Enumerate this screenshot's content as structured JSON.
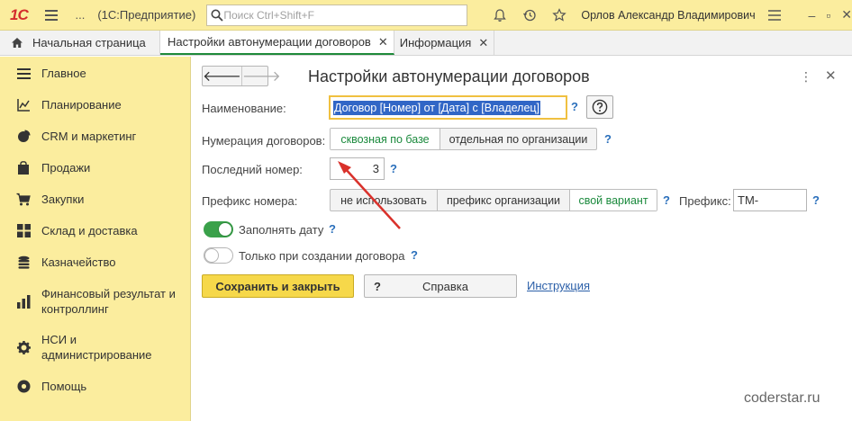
{
  "topbar": {
    "logo_text": "1С",
    "dots": "...",
    "app_title": "(1С:Предприятие)",
    "search_placeholder": "Поиск Ctrl+Shift+F",
    "user_name": "Орлов Александр Владимирович",
    "icons": [
      "bell-icon",
      "history-icon",
      "star-icon",
      "menu-lines-icon"
    ]
  },
  "tabs": [
    {
      "label": "Начальная страница"
    },
    {
      "label": "Настройки автонумерации договоров",
      "active": true
    },
    {
      "label": "Информация"
    }
  ],
  "sidebar": {
    "items": [
      {
        "label": "Главное",
        "icon": "menu-icon"
      },
      {
        "label": "Планирование",
        "icon": "planning-icon"
      },
      {
        "label": "CRM и маркетинг",
        "icon": "pie-chart-icon"
      },
      {
        "label": "Продажи",
        "icon": "bag-icon"
      },
      {
        "label": "Закупки",
        "icon": "cart-icon"
      },
      {
        "label": "Склад и доставка",
        "icon": "warehouse-icon"
      },
      {
        "label": "Казначейство",
        "icon": "coins-icon"
      },
      {
        "label": "Финансовый результат и контроллинг",
        "label_line1": "Финансовый результат и",
        "label_line2": "контроллинг",
        "icon": "bar-chart-icon"
      },
      {
        "label": "НСИ и администрирование",
        "label_line1": "НСИ и",
        "label_line2": "администрирование",
        "icon": "gear-icon"
      },
      {
        "label": "Помощь",
        "icon": "help-icon"
      }
    ]
  },
  "form": {
    "title": "Настройки автонумерации договоров",
    "name_label": "Наименование:",
    "name_value": "Договор [Номер] от [Дата] с [Владелец]",
    "numbering_label": "Нумерация договоров:",
    "numbering_options": [
      "сквозная по базе",
      "отдельная по организации"
    ],
    "numbering_selected": "сквозная по базе",
    "last_number_label": "Последний номер:",
    "last_number_value": "3",
    "prefix_label": "Префикс номера:",
    "prefix_options": [
      "не использовать",
      "префикс организации",
      "свой вариант"
    ],
    "prefix_selected": "свой вариант",
    "prefix_field_label": "Префикс:",
    "prefix_field_value": "ТМ-",
    "fill_date_label": "Заполнять дату",
    "fill_date_on": true,
    "only_on_create_label": "Только при создании договора",
    "only_on_create_on": false,
    "help_q": "?",
    "save_button": "Сохранить и закрыть",
    "help_button_q": "?",
    "help_button": "Справка",
    "instruction_link": "Инструкция"
  },
  "watermark": "coderstar.ru",
  "colors": {
    "accent_yellow": "#fbed9e",
    "primary_button": "#f6d84a",
    "selected_green": "#1b8a3d",
    "toggle_green": "#3aa14a",
    "link_blue": "#2b5fa8",
    "annotation_arrow": "#d9312b"
  }
}
